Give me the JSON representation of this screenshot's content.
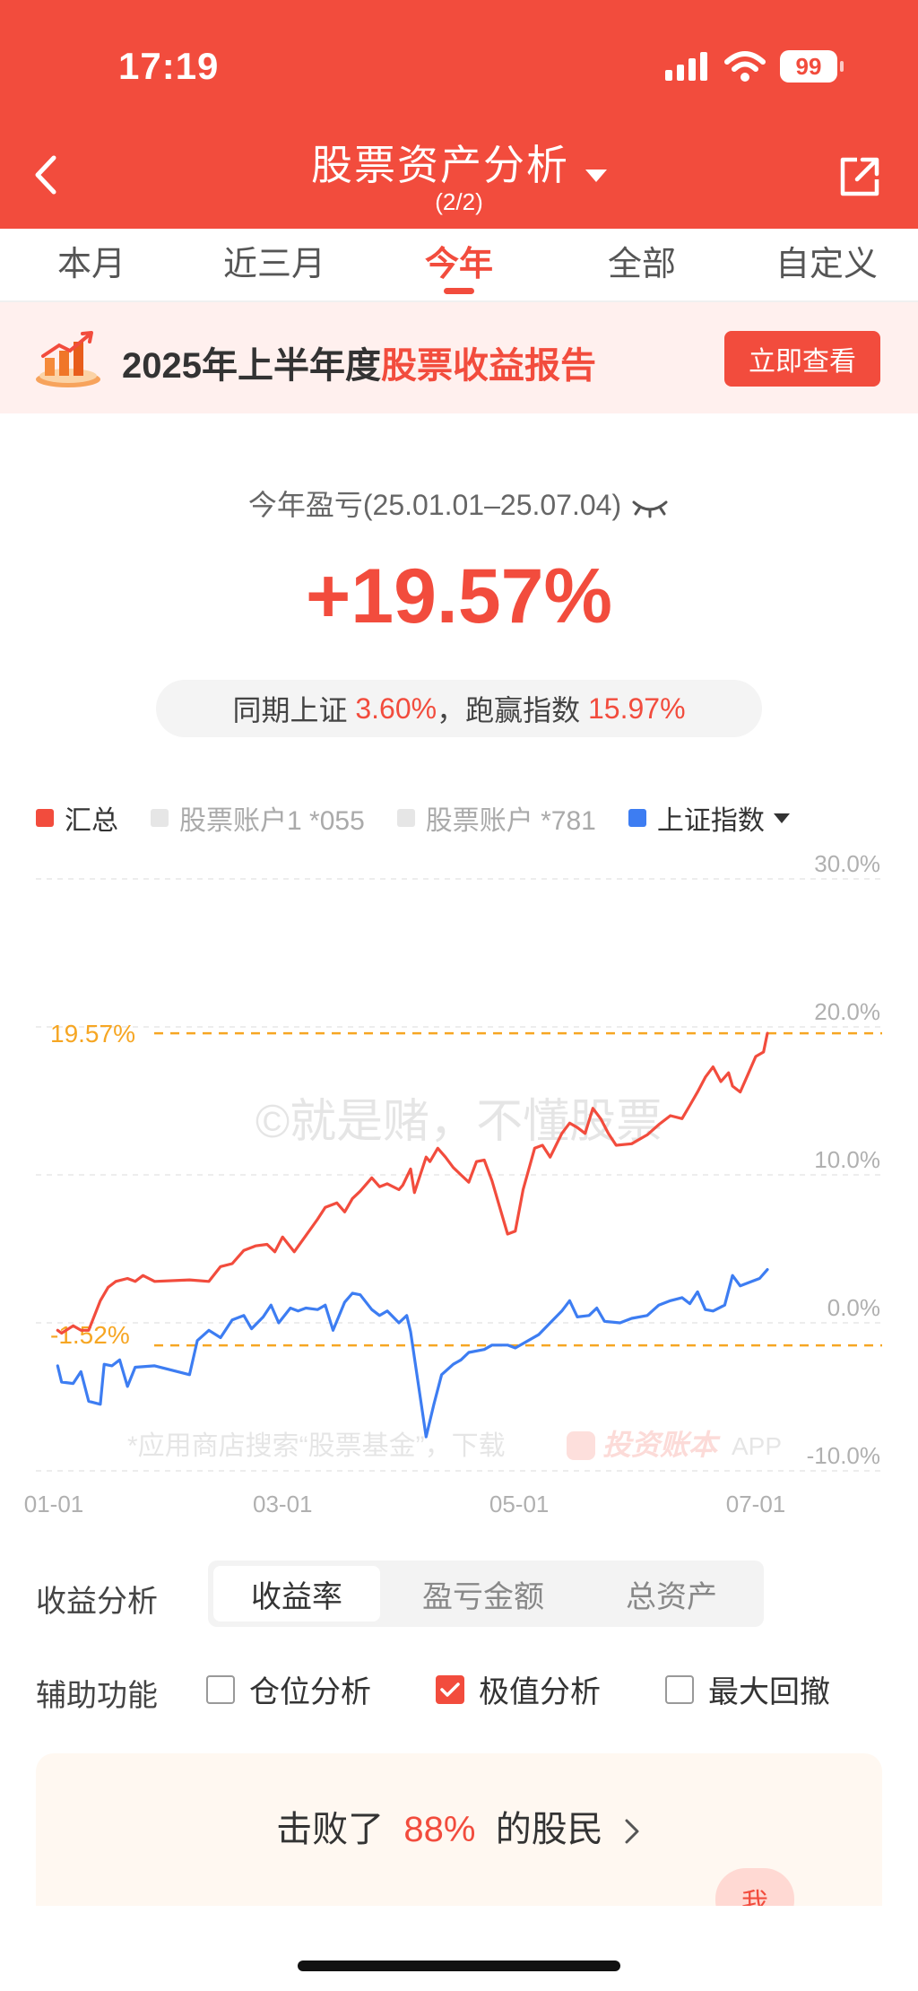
{
  "status_bar": {
    "time": "17:19",
    "battery": "99"
  },
  "header": {
    "title": "股票资产分析",
    "subtitle": "(2/2)"
  },
  "tabs": [
    {
      "label": "本月",
      "active": false
    },
    {
      "label": "近三月",
      "active": false
    },
    {
      "label": "今年",
      "active": true
    },
    {
      "label": "全部",
      "active": false
    },
    {
      "label": "自定义",
      "active": false
    }
  ],
  "banner": {
    "text_prefix": "2025年上半年度",
    "text_highlight": "股票收益报告",
    "button": "立即查看"
  },
  "summary": {
    "period": "今年盈亏(25.01.01–25.07.04)",
    "pnl": "+19.57%",
    "compare_prefix": "同期上证",
    "index_return": "3.60%",
    "compare_mid": "，跑赢指数",
    "excess_return": "15.97%"
  },
  "legend": [
    {
      "label": "汇总",
      "color": "#f24c3d",
      "active": true
    },
    {
      "label": "股票账户1 *055",
      "color": "#e6e6e6",
      "active": false
    },
    {
      "label": "股票账户 *781",
      "color": "#e6e6e6",
      "active": false
    },
    {
      "label": "上证指数",
      "color": "#3d7df2",
      "active": true,
      "has_dropdown": true
    }
  ],
  "chart_data": {
    "type": "line",
    "y_ticks": [
      "30.0%",
      "20.0%",
      "10.0%",
      "0.0%",
      "-10.0%"
    ],
    "x_ticks": [
      "01-01",
      "03-01",
      "05-01",
      "07-01"
    ],
    "ylim": [
      -10,
      30
    ],
    "xlim": [
      "2025-01-01",
      "2025-07-04"
    ],
    "max_line": {
      "value": 19.57,
      "label": "19.57%"
    },
    "min_line": {
      "value": -1.52,
      "label": "-1.52%"
    },
    "watermark": "©就是赌，不懂股票",
    "footer_text": "*应用商店搜索“股票基金”，下载",
    "footer_brand": "投资账本",
    "footer_brand_suffix": "APP",
    "series": [
      {
        "name": "汇总",
        "color": "#f24c3d",
        "points": [
          [
            "2025-01-02",
            -0.5
          ],
          [
            "2025-01-03",
            -0.7
          ],
          [
            "2025-01-06",
            -0.2
          ],
          [
            "2025-01-08",
            -0.5
          ],
          [
            "2025-01-10",
            -0.5
          ],
          [
            "2025-01-13",
            1.5
          ],
          [
            "2025-01-15",
            2.4
          ],
          [
            "2025-01-17",
            2.8
          ],
          [
            "2025-01-20",
            3.0
          ],
          [
            "2025-01-22",
            2.8
          ],
          [
            "2025-01-24",
            3.2
          ],
          [
            "2025-01-27",
            2.8
          ],
          [
            "2025-02-05",
            2.9
          ],
          [
            "2025-02-10",
            2.8
          ],
          [
            "2025-02-13",
            3.8
          ],
          [
            "2025-02-16",
            4.0
          ],
          [
            "2025-02-19",
            4.9
          ],
          [
            "2025-02-22",
            5.2
          ],
          [
            "2025-02-25",
            5.3
          ],
          [
            "2025-02-27",
            4.8
          ],
          [
            "2025-03-01",
            5.8
          ],
          [
            "2025-03-04",
            4.8
          ],
          [
            "2025-03-07",
            5.9
          ],
          [
            "2025-03-10",
            7.0
          ],
          [
            "2025-03-12",
            7.8
          ],
          [
            "2025-03-15",
            8.1
          ],
          [
            "2025-03-17",
            7.5
          ],
          [
            "2025-03-19",
            8.4
          ],
          [
            "2025-03-21",
            8.9
          ],
          [
            "2025-03-24",
            9.8
          ],
          [
            "2025-03-26",
            9.2
          ],
          [
            "2025-03-28",
            9.4
          ],
          [
            "2025-03-31",
            9.0
          ],
          [
            "2025-04-01",
            9.3
          ],
          [
            "2025-04-03",
            10.4
          ],
          [
            "2025-04-04",
            8.8
          ],
          [
            "2025-04-07",
            11.2
          ],
          [
            "2025-04-08",
            10.9
          ],
          [
            "2025-04-10",
            11.8
          ],
          [
            "2025-04-12",
            11.2
          ],
          [
            "2025-04-14",
            10.5
          ],
          [
            "2025-04-16",
            10.0
          ],
          [
            "2025-04-18",
            9.5
          ],
          [
            "2025-04-20",
            10.9
          ],
          [
            "2025-04-22",
            11.0
          ],
          [
            "2025-04-24",
            9.6
          ],
          [
            "2025-04-26",
            7.8
          ],
          [
            "2025-04-28",
            6.0
          ],
          [
            "2025-04-30",
            6.2
          ],
          [
            "2025-05-02",
            9.0
          ],
          [
            "2025-05-05",
            11.8
          ],
          [
            "2025-05-07",
            12.0
          ],
          [
            "2025-05-09",
            11.2
          ],
          [
            "2025-05-12",
            12.8
          ],
          [
            "2025-05-14",
            13.5
          ],
          [
            "2025-05-16",
            13.2
          ],
          [
            "2025-05-18",
            12.8
          ],
          [
            "2025-05-20",
            14.5
          ],
          [
            "2025-05-22",
            13.8
          ],
          [
            "2025-05-24",
            12.8
          ],
          [
            "2025-05-26",
            12.0
          ],
          [
            "2025-05-30",
            12.1
          ],
          [
            "2025-06-03",
            12.7
          ],
          [
            "2025-06-06",
            13.4
          ],
          [
            "2025-06-09",
            14.0
          ],
          [
            "2025-06-12",
            13.8
          ],
          [
            "2025-06-14",
            14.7
          ],
          [
            "2025-06-16",
            15.6
          ],
          [
            "2025-06-18",
            16.6
          ],
          [
            "2025-06-20",
            17.3
          ],
          [
            "2025-06-22",
            16.3
          ],
          [
            "2025-06-24",
            16.9
          ],
          [
            "2025-06-25",
            16.0
          ],
          [
            "2025-06-27",
            15.6
          ],
          [
            "2025-06-29",
            16.8
          ],
          [
            "2025-07-01",
            18.0
          ],
          [
            "2025-07-03",
            18.3
          ],
          [
            "2025-07-04",
            19.57
          ]
        ]
      },
      {
        "name": "上证指数",
        "color": "#3d7df2",
        "points": [
          [
            "2025-01-02",
            -2.9
          ],
          [
            "2025-01-03",
            -4.0
          ],
          [
            "2025-01-06",
            -4.1
          ],
          [
            "2025-01-08",
            -3.3
          ],
          [
            "2025-01-10",
            -5.3
          ],
          [
            "2025-01-13",
            -5.5
          ],
          [
            "2025-01-14",
            -2.8
          ],
          [
            "2025-01-16",
            -2.9
          ],
          [
            "2025-01-18",
            -2.5
          ],
          [
            "2025-01-20",
            -4.3
          ],
          [
            "2025-01-22",
            -3.0
          ],
          [
            "2025-01-27",
            -2.9
          ],
          [
            "2025-02-05",
            -3.5
          ],
          [
            "2025-02-07",
            -1.2
          ],
          [
            "2025-02-10",
            -0.5
          ],
          [
            "2025-02-13",
            -1.0
          ],
          [
            "2025-02-16",
            0.2
          ],
          [
            "2025-02-19",
            0.5
          ],
          [
            "2025-02-21",
            -0.4
          ],
          [
            "2025-02-24",
            0.4
          ],
          [
            "2025-02-26",
            1.2
          ],
          [
            "2025-02-28",
            0.0
          ],
          [
            "2025-03-03",
            1.0
          ],
          [
            "2025-03-05",
            0.8
          ],
          [
            "2025-03-07",
            1.0
          ],
          [
            "2025-03-10",
            0.9
          ],
          [
            "2025-03-12",
            1.2
          ],
          [
            "2025-03-14",
            -0.5
          ],
          [
            "2025-03-17",
            1.4
          ],
          [
            "2025-03-19",
            2.0
          ],
          [
            "2025-03-21",
            1.9
          ],
          [
            "2025-03-24",
            0.9
          ],
          [
            "2025-03-26",
            0.5
          ],
          [
            "2025-03-28",
            0.8
          ],
          [
            "2025-03-31",
            0.0
          ],
          [
            "2025-04-02",
            0.5
          ],
          [
            "2025-04-03",
            -0.6
          ],
          [
            "2025-04-07",
            -7.7
          ],
          [
            "2025-04-09",
            -5.5
          ],
          [
            "2025-04-11",
            -3.5
          ],
          [
            "2025-04-14",
            -2.8
          ],
          [
            "2025-04-16",
            -2.5
          ],
          [
            "2025-04-18",
            -2.0
          ],
          [
            "2025-04-22",
            -1.8
          ],
          [
            "2025-04-24",
            -1.5
          ],
          [
            "2025-04-28",
            -1.5
          ],
          [
            "2025-04-30",
            -1.7
          ],
          [
            "2025-05-06",
            -0.8
          ],
          [
            "2025-05-09",
            0.0
          ],
          [
            "2025-05-12",
            0.8
          ],
          [
            "2025-05-14",
            1.5
          ],
          [
            "2025-05-16",
            0.4
          ],
          [
            "2025-05-19",
            0.5
          ],
          [
            "2025-05-21",
            1.0
          ],
          [
            "2025-05-23",
            0.1
          ],
          [
            "2025-05-27",
            0.0
          ],
          [
            "2025-05-30",
            0.3
          ],
          [
            "2025-06-03",
            0.5
          ],
          [
            "2025-06-06",
            1.2
          ],
          [
            "2025-06-09",
            1.5
          ],
          [
            "2025-06-12",
            1.7
          ],
          [
            "2025-06-14",
            1.3
          ],
          [
            "2025-06-16",
            2.1
          ],
          [
            "2025-06-18",
            0.9
          ],
          [
            "2025-06-20",
            0.8
          ],
          [
            "2025-06-23",
            1.2
          ],
          [
            "2025-06-25",
            3.2
          ],
          [
            "2025-06-27",
            2.5
          ],
          [
            "2025-06-30",
            2.8
          ],
          [
            "2025-07-02",
            3.0
          ],
          [
            "2025-07-04",
            3.6
          ]
        ]
      }
    ]
  },
  "analysis": {
    "label": "收益分析",
    "options": [
      {
        "label": "收益率",
        "active": true
      },
      {
        "label": "盈亏金额",
        "active": false
      },
      {
        "label": "总资产",
        "active": false
      }
    ]
  },
  "aux": {
    "label": "辅助功能",
    "options": [
      {
        "label": "仓位分析",
        "checked": false
      },
      {
        "label": "极值分析",
        "checked": true
      },
      {
        "label": "最大回撤",
        "checked": false
      }
    ]
  },
  "rank": {
    "prefix": "击败了",
    "value": "88%",
    "suffix": "的股民",
    "badge": "我"
  }
}
